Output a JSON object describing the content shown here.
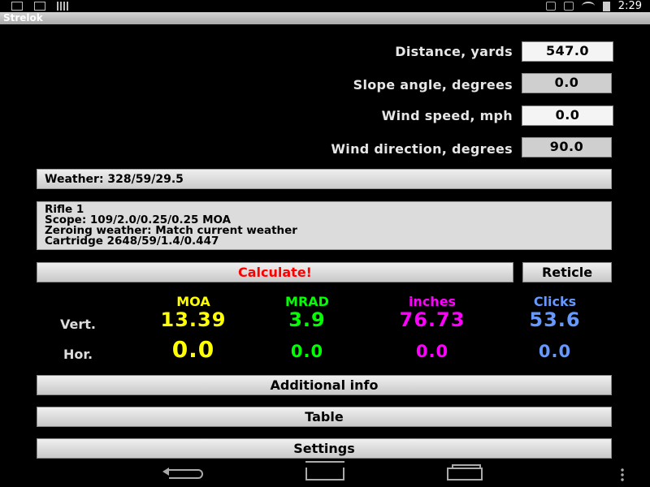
{
  "status_bar": {
    "time": "2:29",
    "left_icons": [
      "download-icon",
      "usb-debug-icon",
      "barcode-icon"
    ],
    "right_icons": [
      "bluetooth-icon",
      "airplane-icon",
      "wifi-icon",
      "battery-icon"
    ]
  },
  "app": {
    "title": "Strelok"
  },
  "fields": [
    {
      "label": "Distance, yards",
      "value": "547.0"
    },
    {
      "label": "Slope angle, degrees",
      "value": "0.0"
    },
    {
      "label": "Wind speed, mph",
      "value": "0.0"
    },
    {
      "label": "Wind direction, degrees",
      "value": "90.0"
    }
  ],
  "weather": {
    "text": "Weather: 328/59/29.5"
  },
  "rifle": {
    "name": "Rifle 1",
    "scope": "Scope: 109/2.0/0.25/0.25 MOA",
    "zeroing": "Zeroing weather: Match current weather",
    "cartridge": "Cartridge 2648/59/1.4/0.447"
  },
  "buttons": {
    "calculate": "Calculate!",
    "reticle": "Reticle",
    "additional_info": "Additional info",
    "table": "Table",
    "settings": "Settings"
  },
  "results": {
    "columns": [
      {
        "label": "MOA",
        "color": "#ffff00"
      },
      {
        "label": "MRAD",
        "color": "#00ff00"
      },
      {
        "label": "inches",
        "color": "#ff00ff"
      },
      {
        "label": "Clicks",
        "color": "#6699ff"
      }
    ],
    "rows": [
      {
        "label": "Vert.",
        "values": [
          "13.39",
          "3.9",
          "76.73",
          "53.6"
        ]
      },
      {
        "label": "Hor.",
        "values": [
          "0.0",
          "0.0",
          "0.0",
          "0.0"
        ]
      }
    ]
  },
  "colors": {
    "calculate_text": "#ff0000",
    "moa": "#ffff00",
    "mrad": "#00ff00",
    "inches": "#ff00ff",
    "clicks": "#6699ff"
  }
}
